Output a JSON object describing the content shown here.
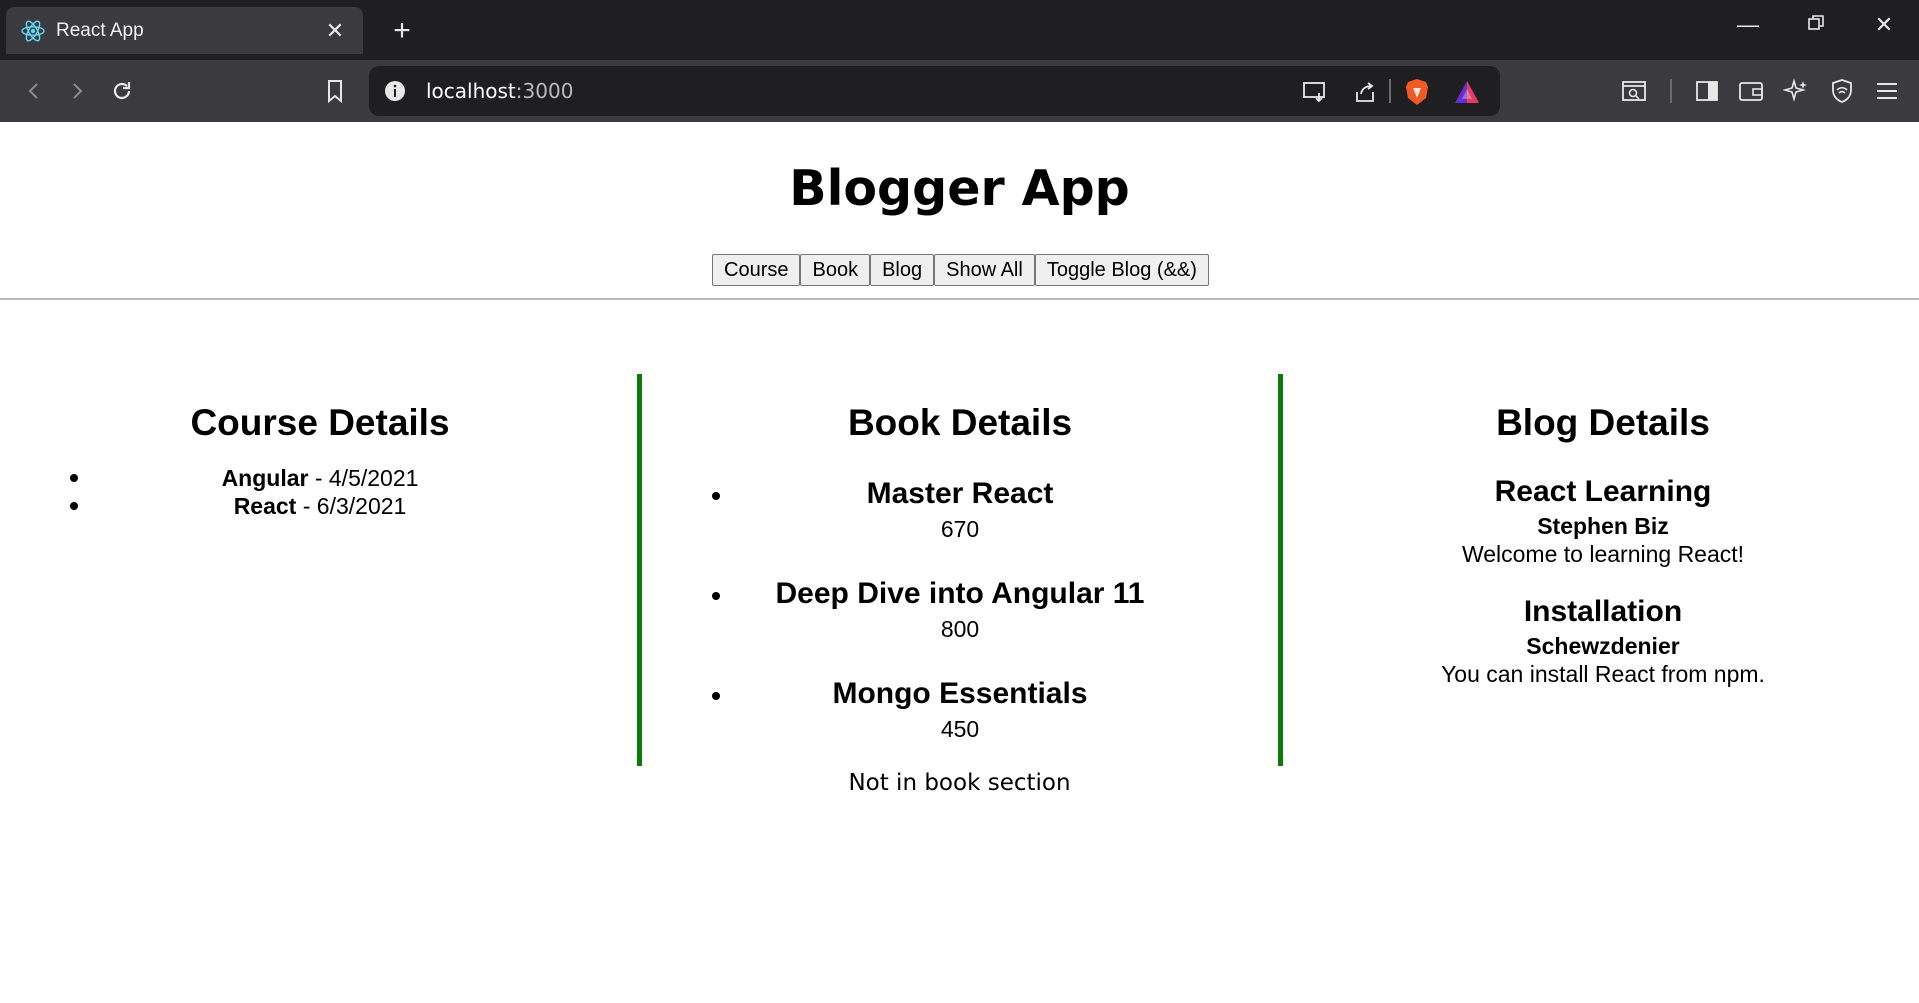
{
  "browser": {
    "tab_title": "React App",
    "url_host": "localhost",
    "url_port": ":3000",
    "accent_brave": "#f25a24"
  },
  "app": {
    "title": "Blogger App",
    "buttons": [
      "Course",
      "Book",
      "Blog",
      "Show All",
      "Toggle Blog (&&)"
    ],
    "divider_color": "#0a7c0a"
  },
  "course": {
    "heading": "Course Details",
    "items": [
      {
        "name": "Angular",
        "date": " - 4/5/2021"
      },
      {
        "name": "React",
        "date": " - 6/3/2021"
      }
    ]
  },
  "book": {
    "heading": "Book Details",
    "items": [
      {
        "title": "Master React",
        "price": "670"
      },
      {
        "title": "Deep Dive into Angular 11",
        "price": "800"
      },
      {
        "title": "Mongo Essentials",
        "price": "450"
      }
    ]
  },
  "blog": {
    "heading": "Blog Details",
    "items": [
      {
        "title": "React Learning",
        "author": "Stephen Biz",
        "content": "Welcome to learning React!"
      },
      {
        "title": "Installation",
        "author": "Schewzdenier",
        "content": "You can install React from npm."
      }
    ]
  },
  "footer_note": "Not in book section"
}
